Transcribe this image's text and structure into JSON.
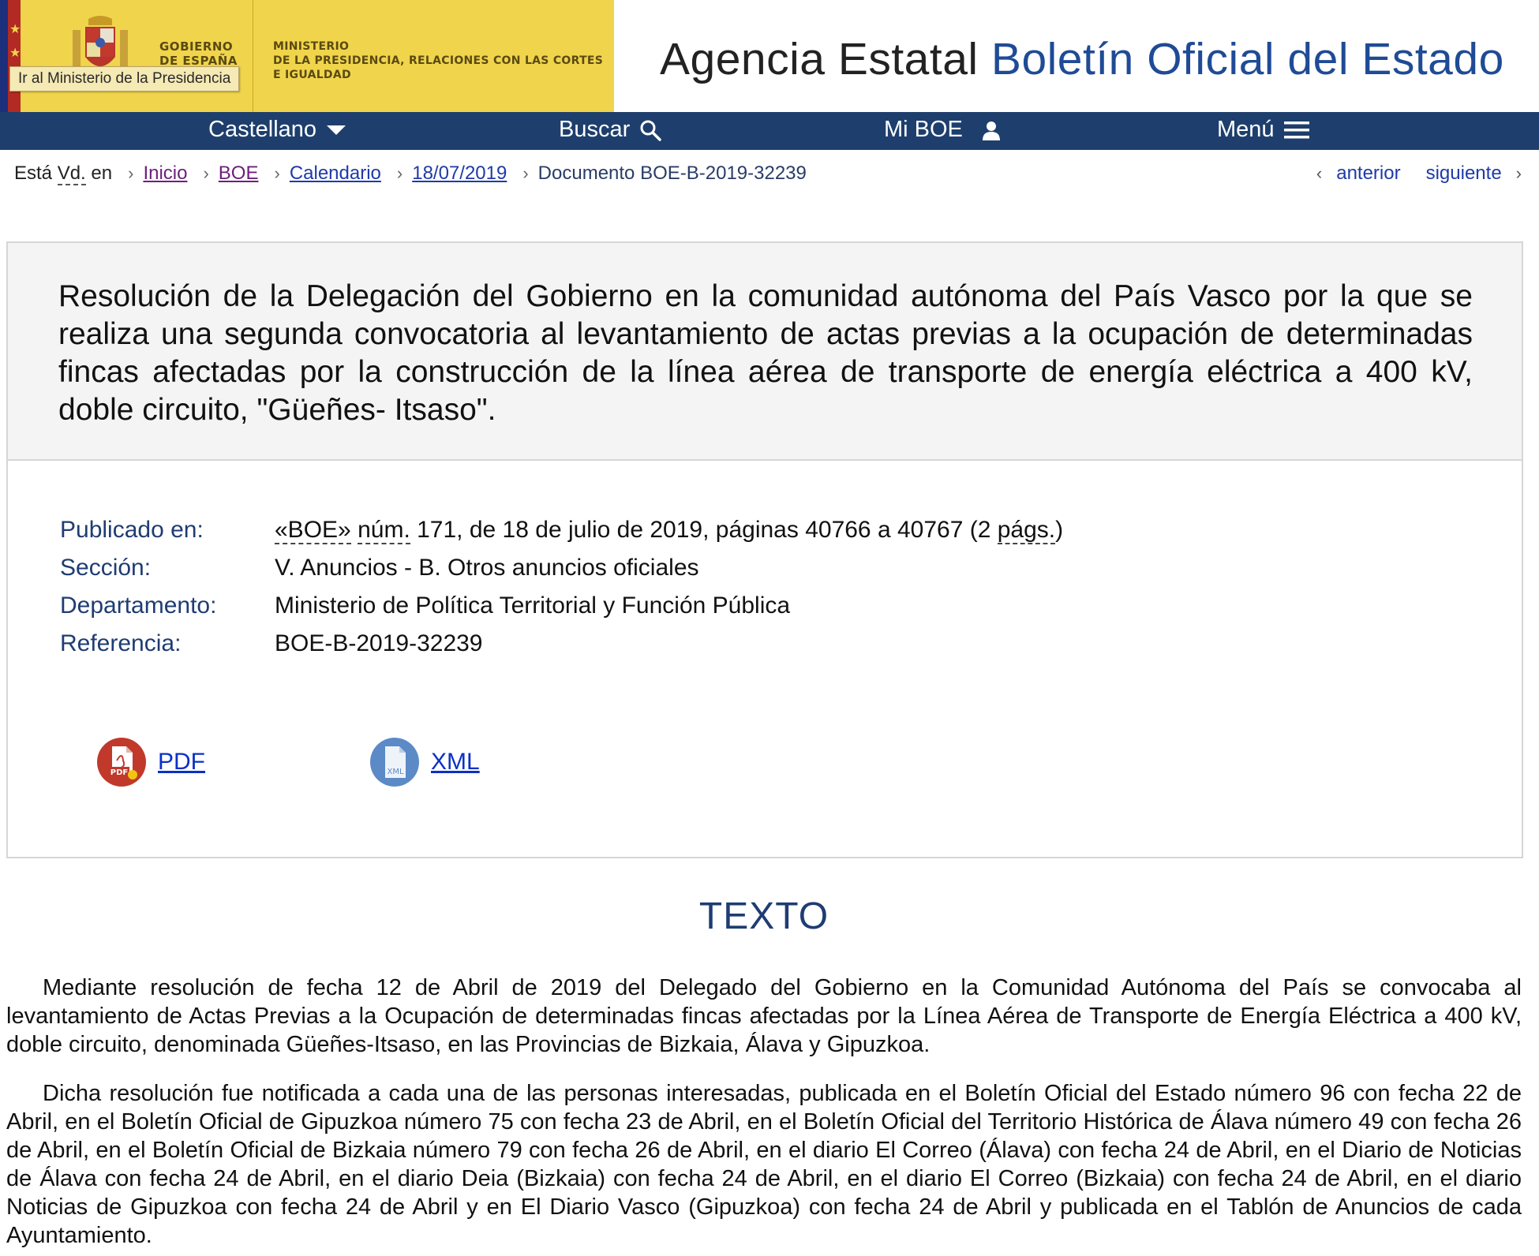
{
  "header": {
    "gov_label_line1": "GOBIERNO",
    "gov_label_line2": "DE ESPAÑA",
    "ministry_line1": "MINISTERIO",
    "ministry_line2": "DE LA PRESIDENCIA, RELACIONES CON LAS CORTES",
    "ministry_line3": "E IGUALDAD",
    "tooltip": "Ir al Ministerio de la Presidencia",
    "agency_prefix": "Agencia Estatal",
    "agency_name": "Boletín Oficial del Estado",
    "colors": {
      "gov_yellow": "#f0d44b",
      "nav_blue": "#1e3f6d",
      "title_blue": "#1f4b96"
    }
  },
  "nav": {
    "language": "Castellano",
    "search": "Buscar",
    "my_boe": "Mi BOE",
    "menu": "Menú"
  },
  "breadcrumb": {
    "lead_prefix": "Está",
    "lead_abbr": "Vd.",
    "lead_suffix": "en",
    "items": [
      "Inicio",
      "BOE",
      "Calendario",
      "18/07/2019"
    ],
    "current": "Documento BOE-B-2019-32239",
    "previous": "anterior",
    "next": "siguiente"
  },
  "document": {
    "title": "Resolución de la Delegación del Gobierno en la comunidad autónoma del País Vasco por la que se realiza una segunda convocatoria al levantamiento de actas previas a la ocupación de determinadas fincas afectadas por la construcción de la línea aérea de transporte de energía eléctrica a 400 kV, doble circuito, \"Güeñes- Itsaso\".",
    "meta": {
      "published_label": "Publicado en:",
      "published_boe": "«BOE»",
      "published_num": "núm.",
      "published_rest": "171, de 18 de julio de 2019, páginas 40766 a 40767 (2",
      "published_pags": "págs.",
      "published_close": ")",
      "section_label": "Sección:",
      "section_value": "V. Anuncios - B. Otros anuncios oficiales",
      "department_label": "Departamento:",
      "department_value": "Ministerio de Política Territorial y Función Pública",
      "reference_label": "Referencia:",
      "reference_value": "BOE-B-2019-32239"
    },
    "downloads": {
      "pdf_label": "PDF",
      "pdf_icon_text": "PDF",
      "xml_label": "XML",
      "xml_icon_text": "XML"
    }
  },
  "texto": {
    "heading": "TEXTO",
    "paragraphs": [
      "Mediante resolución de fecha 12 de Abril de 2019 del Delegado del Gobierno en la Comunidad Autónoma del País se convocaba al levantamiento de Actas Previas a la Ocupación de determinadas fincas afectadas por la Línea Aérea de Transporte de Energía Eléctrica a 400 kV, doble circuito, denominada Güeñes-Itsaso, en las Provincias de Bizkaia, Álava y Gipuzkoa.",
      "Dicha resolución fue notificada a cada una de las personas interesadas, publicada en el Boletín Oficial del Estado número 96 con fecha 22 de Abril, en el Boletín Oficial de Gipuzkoa número 75 con fecha 23 de Abril, en el Boletín Oficial del Territorio Histórica de Álava número 49 con fecha 26 de Abril, en el Boletín Oficial de Bizkaia número 79 con fecha 26 de Abril, en el diario El Correo (Álava) con fecha 24 de Abril, en el Diario de Noticias de Álava con fecha 24 de Abril, en el diario Deia (Bizkaia) con fecha 24 de Abril, en el diario El Correo (Bizkaia) con fecha 24 de Abril, en el diario Noticias de Gipuzkoa con fecha 24 de Abril y en El Diario Vasco (Gipuzkoa) con fecha 24 de Abril y publicada en el Tablón de Anuncios de cada Ayuntamiento."
    ]
  }
}
